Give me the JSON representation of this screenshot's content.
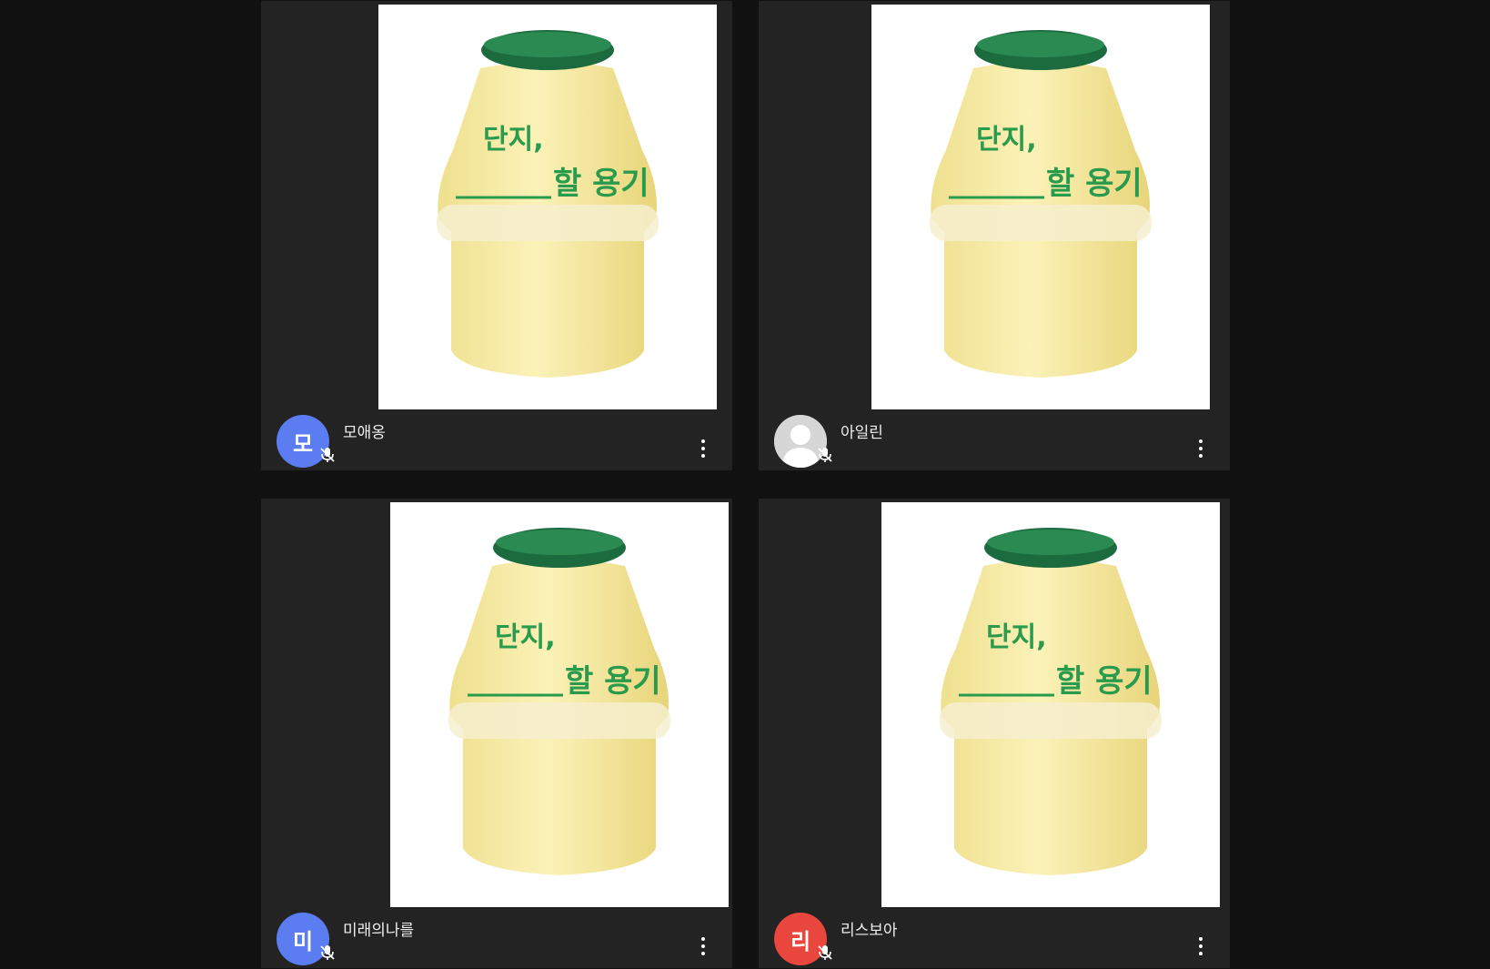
{
  "participants": [
    {
      "name": "모애옹",
      "initial": "모",
      "avatar_color": "#5c7cf2",
      "avatar_type": "initial",
      "muted": true
    },
    {
      "name": "아일린",
      "initial": "",
      "avatar_color": "#c8c8c8",
      "avatar_type": "photo-placeholder",
      "muted": true
    },
    {
      "name": "미래의나를",
      "initial": "미",
      "avatar_color": "#5c7cf2",
      "avatar_type": "initial",
      "muted": true
    },
    {
      "name": "리스보아",
      "initial": "리",
      "avatar_color": "#e9473d",
      "avatar_type": "initial",
      "muted": true
    }
  ],
  "shared_image": {
    "bottle_text_top": "단지,",
    "bottle_text_bottom": "할 용기"
  },
  "icons": {
    "mic": "microphone-off-icon",
    "more": "more-vert-icon"
  }
}
